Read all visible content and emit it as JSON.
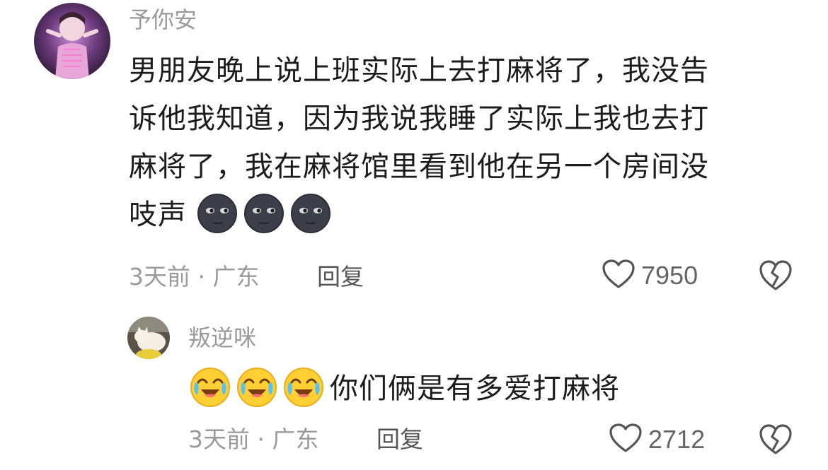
{
  "comments": [
    {
      "username": "予你安",
      "lines": [
        "男朋友晚上说上班实际上去打麻将了，我没告",
        "诉他我知道，因为我说我睡了实际上我也去打",
        "麻将了，我在麻将馆里看到他在另一个房间没",
        "吱声"
      ],
      "emojis": [
        "new-moon-face-icon",
        "new-moon-face-icon",
        "new-moon-face-icon"
      ],
      "time_location": "3天前 · 广东",
      "reply_label": "回复",
      "likes": "7950"
    },
    {
      "username": "叛逆咪",
      "emojis": [
        "crying-laughing-face-icon",
        "crying-laughing-face-icon",
        "crying-laughing-face-icon"
      ],
      "text": "你们俩是有多爱打麻将",
      "time_location": "3天前 · 广东",
      "reply_label": "回复",
      "likes": "2712"
    }
  ]
}
